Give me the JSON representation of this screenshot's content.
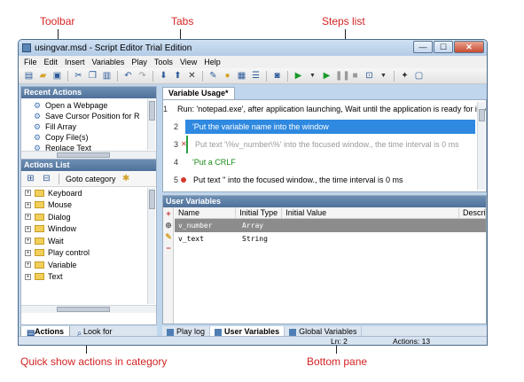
{
  "annotations": {
    "toolbar": "Toolbar",
    "tabs": "Tabs",
    "steps_list": "Steps list",
    "quick_show": "Quick show actions in category",
    "bottom_pane": "Bottom pane"
  },
  "window": {
    "title": "usingvar.msd - Script Editor  Trial Edition",
    "min": "—",
    "max": "☐",
    "close": "✕"
  },
  "menu": [
    "File",
    "Edit",
    "Insert",
    "Variables",
    "Play",
    "Tools",
    "View",
    "Help"
  ],
  "left_panel": {
    "recent_title": "Recent Actions",
    "recent_items": [
      "Open a Webpage",
      "Save Cursor Position for R",
      "Fill Array",
      "Copy File(s)",
      "Replace Text"
    ],
    "actions_title": "Actions List",
    "goto_category": "Goto category",
    "tree": [
      "Keyboard",
      "Mouse",
      "Dialog",
      "Window",
      "Wait",
      "Play control",
      "Variable",
      "Text"
    ],
    "tabs": [
      "Actions",
      "Look for"
    ]
  },
  "doc_tab": "Variable Usage*",
  "steps": [
    {
      "num": "1",
      "text": "Run: 'notepad.exe', after application launching, Wait until the application is ready for input.",
      "color": "#000000"
    },
    {
      "num": "2",
      "text": "'Put the variable name into the window",
      "color": "#1a8a1a",
      "selected": true
    },
    {
      "num": "3",
      "text": "Put text '\\%v_number\\%' into the focused window., the time interval is 0 ms",
      "color": "#9a9a9a"
    },
    {
      "num": "4",
      "text": "'Put a CRLF",
      "color": "#1a8a1a"
    },
    {
      "num": "5",
      "text": "Put text '' into the focused window., the time interval is 0 ms",
      "color": "#000000"
    }
  ],
  "user_vars": {
    "title": "User Variables",
    "columns": [
      "Name",
      "Initial Type",
      "Initial Value",
      "Description"
    ],
    "rows": [
      {
        "name": "v_number",
        "type": "Array",
        "value": ""
      },
      {
        "name": "v_text",
        "type": "String",
        "value": ""
      }
    ]
  },
  "bottom_tabs": [
    "Play log",
    "User Variables",
    "Global Variables"
  ],
  "status": {
    "line": "Ln: 2",
    "actions": "Actions: 13"
  }
}
